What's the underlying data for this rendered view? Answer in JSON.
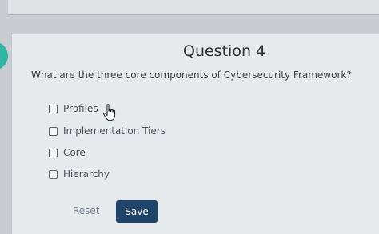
{
  "question": {
    "title": "Question 4",
    "text": "What are the three core components of Cybersecurity Framework?",
    "options": [
      {
        "label": "Profiles",
        "checked": false
      },
      {
        "label": "Implementation Tiers",
        "checked": false
      },
      {
        "label": "Core",
        "checked": false
      },
      {
        "label": "Hierarchy",
        "checked": false
      }
    ]
  },
  "actions": {
    "reset_label": "Reset",
    "save_label": "Save"
  },
  "colors": {
    "save_button": "#20456c",
    "side_tab": "#2fb7a4"
  },
  "icons": {
    "cursor": "hand-pointer-icon"
  }
}
